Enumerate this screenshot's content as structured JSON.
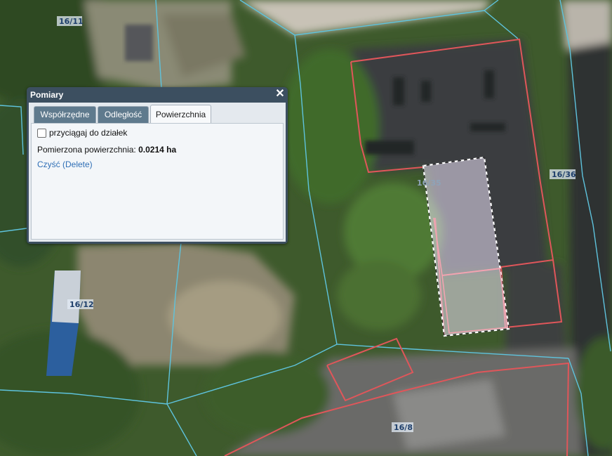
{
  "map": {
    "parcels": {
      "p16_11": "16/11",
      "p16_12": "16/12",
      "p16_35": "16/35",
      "p16_36": "16/36",
      "p16_8": "16/8"
    },
    "colors": {
      "parcel_boundary": "#5ec3dd",
      "building_outline": "#e0565a",
      "measure_fill": "rgba(235,225,245,0.55)"
    }
  },
  "dialog": {
    "title": "Pomiary",
    "close_icon": "close-icon",
    "tabs": [
      {
        "label": "Współrzędne",
        "active": false
      },
      {
        "label": "Odległość",
        "active": false
      },
      {
        "label": "Powierzchnia",
        "active": true
      }
    ],
    "snap_label": "przyciągaj do działek",
    "snap_checked": false,
    "area_label": "Pomierzona powierzchnia:",
    "area_value": "0.0214 ha",
    "clear_link": "Czyść (Delete)"
  }
}
